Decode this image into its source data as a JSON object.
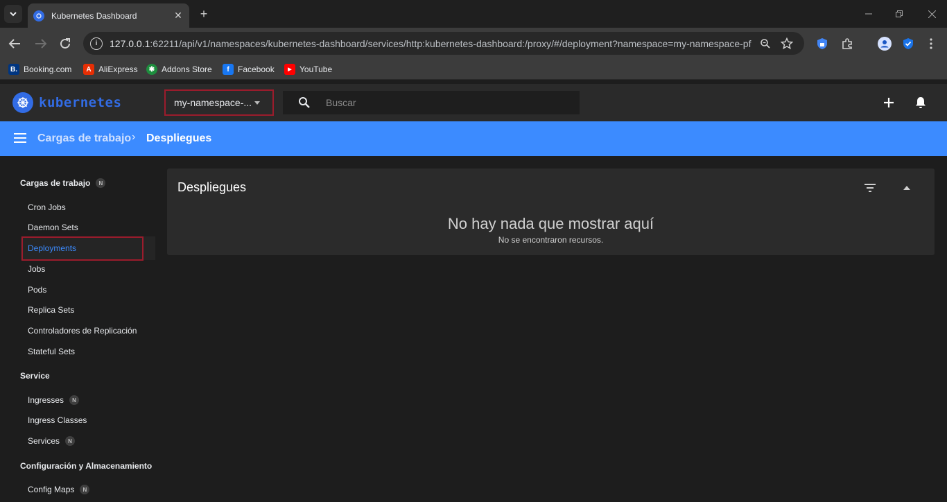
{
  "browser": {
    "tab_title": "Kubernetes Dashboard",
    "tab_close": "✕",
    "new_tab": "+",
    "url_host": "127.0.0.1",
    "url_rest": ":62211/api/v1/namespaces/kubernetes-dashboard/services/http:kubernetes-dashboard:/proxy/#/deployment?namespace=my-namespace-pf",
    "bookmarks": [
      {
        "label": "Booking.com",
        "icon": "booking-icon",
        "color": "#003580",
        "glyph": "B."
      },
      {
        "label": "AliExpress",
        "icon": "aliexpress-icon",
        "color": "#e62e04",
        "glyph": "A"
      },
      {
        "label": "Addons Store",
        "icon": "addons-store-icon",
        "color": "#1e8e3e",
        "glyph": "✱"
      },
      {
        "label": "Facebook",
        "icon": "facebook-icon",
        "color": "#1877f2",
        "glyph": "f"
      },
      {
        "label": "YouTube",
        "icon": "youtube-icon",
        "color": "#ff0000",
        "glyph": "▶"
      }
    ]
  },
  "header": {
    "logo_text": "kubernetes",
    "namespace": "my-namespace-...",
    "search_placeholder": "Buscar"
  },
  "breadcrumb": {
    "parent": "Cargas de trabajo",
    "separator": "›",
    "current": "Despliegues"
  },
  "sidebar": {
    "sections": [
      {
        "label": "Cargas de trabajo",
        "badge": "N"
      },
      {
        "label": "Service",
        "badge": ""
      },
      {
        "label": "Configuración y Almacenamiento",
        "badge": ""
      }
    ],
    "items": [
      {
        "label": "Cron Jobs",
        "badge": ""
      },
      {
        "label": "Daemon Sets",
        "badge": ""
      },
      {
        "label": "Deployments",
        "badge": "",
        "active": true
      },
      {
        "label": "Jobs",
        "badge": ""
      },
      {
        "label": "Pods",
        "badge": ""
      },
      {
        "label": "Replica Sets",
        "badge": ""
      },
      {
        "label": "Controladores de Replicación",
        "badge": ""
      },
      {
        "label": "Stateful Sets",
        "badge": ""
      },
      {
        "label": "Ingresses",
        "badge": "N"
      },
      {
        "label": "Ingress Classes",
        "badge": ""
      },
      {
        "label": "Services",
        "badge": "N"
      },
      {
        "label": "Config Maps",
        "badge": "N"
      }
    ]
  },
  "card": {
    "title": "Despliegues",
    "empty_title": "No hay nada que mostrar aquí",
    "empty_subtitle": "No se encontraron recursos."
  },
  "colors": {
    "accent": "#326ce5",
    "breadcrumb_bg": "#3c8bff",
    "active_link": "#3c8bff",
    "highlight_outline": "#9b1c2c"
  }
}
